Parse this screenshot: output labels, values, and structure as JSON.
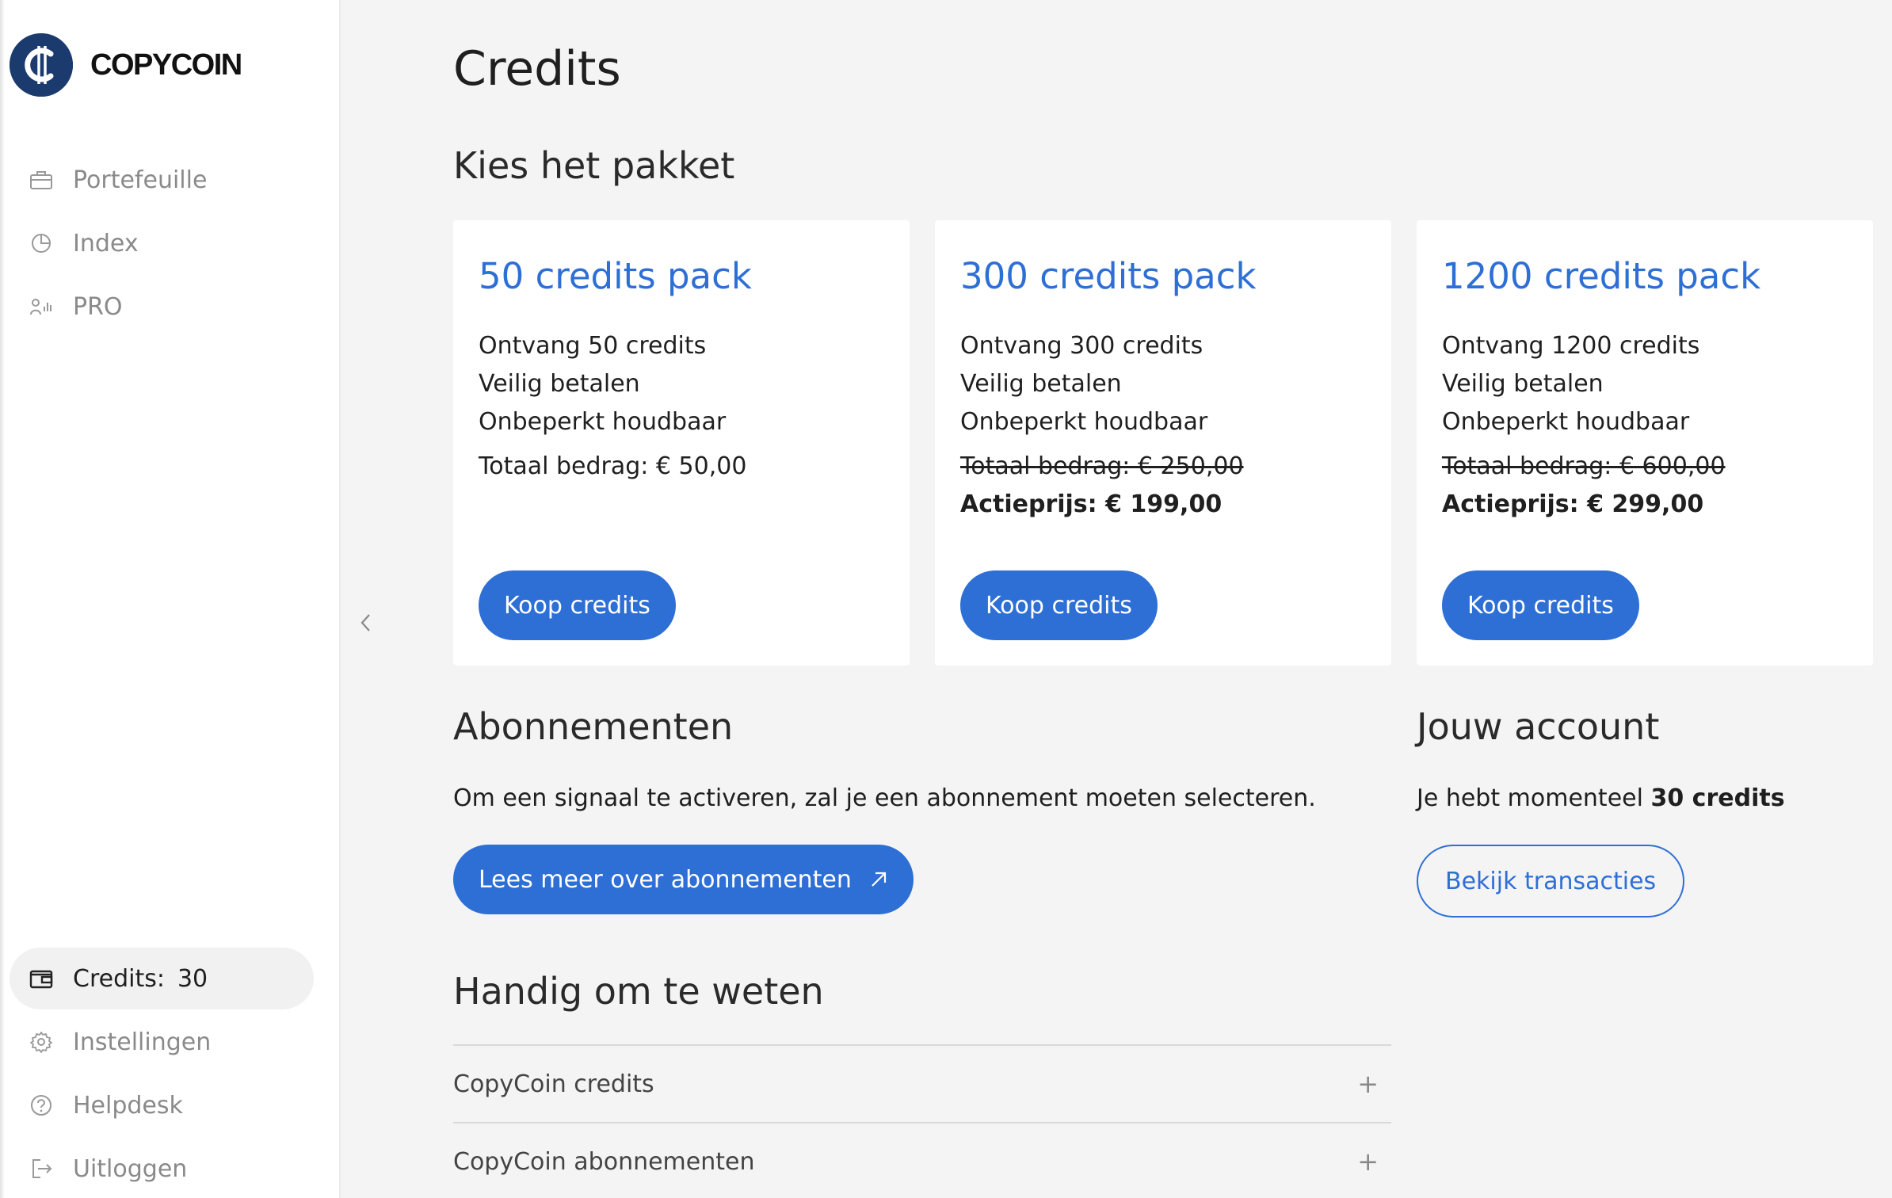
{
  "brand": {
    "name": "COPYCOIN",
    "color": "#1b3b6f",
    "accent": "#2e6fd6"
  },
  "sidebar": {
    "top_items": [
      {
        "label": "Portefeuille",
        "icon": "briefcase-icon"
      },
      {
        "label": "Index",
        "icon": "pie-chart-icon"
      },
      {
        "label": "PRO",
        "icon": "signal-user-icon"
      }
    ],
    "credits": {
      "label": "Credits:",
      "value": "30",
      "icon": "wallet-icon"
    },
    "bottom_items": [
      {
        "label": "Instellingen",
        "icon": "gear-icon"
      },
      {
        "label": "Helpdesk",
        "icon": "help-circle-icon"
      },
      {
        "label": "Uitloggen",
        "icon": "logout-icon"
      }
    ]
  },
  "main": {
    "title": "Credits",
    "packages_title": "Kies het pakket",
    "packages": [
      {
        "title": "50 credits pack",
        "lines": [
          "Ontvang 50 credits",
          "Veilig betalen",
          "Onbeperkt houdbaar"
        ],
        "total": "Totaal bedrag: € 50,00",
        "total_struck": false,
        "action_price": "",
        "button": "Koop credits"
      },
      {
        "title": "300 credits pack",
        "lines": [
          "Ontvang 300 credits",
          "Veilig betalen",
          "Onbeperkt houdbaar"
        ],
        "total": "Totaal bedrag: € 250,00",
        "total_struck": true,
        "action_price": "Actieprijs: € 199,00",
        "button": "Koop credits"
      },
      {
        "title": "1200 credits pack",
        "lines": [
          "Ontvang 1200 credits",
          "Veilig betalen",
          "Onbeperkt houdbaar"
        ],
        "total": "Totaal bedrag: € 600,00",
        "total_struck": true,
        "action_price": "Actieprijs: € 299,00",
        "button": "Koop credits"
      }
    ],
    "subscriptions": {
      "title": "Abonnementen",
      "text": "Om een signaal te activeren, zal je een abonnement moeten selecteren.",
      "button": "Lees meer over abonnementen"
    },
    "account": {
      "title": "Jouw account",
      "text_prefix": "Je hebt momenteel",
      "credits_text": "30 credits",
      "button": "Bekijk transacties"
    },
    "faq": {
      "title": "Handig om te weten",
      "items": [
        "CopyCoin credits",
        "CopyCoin abonnementen"
      ]
    }
  }
}
